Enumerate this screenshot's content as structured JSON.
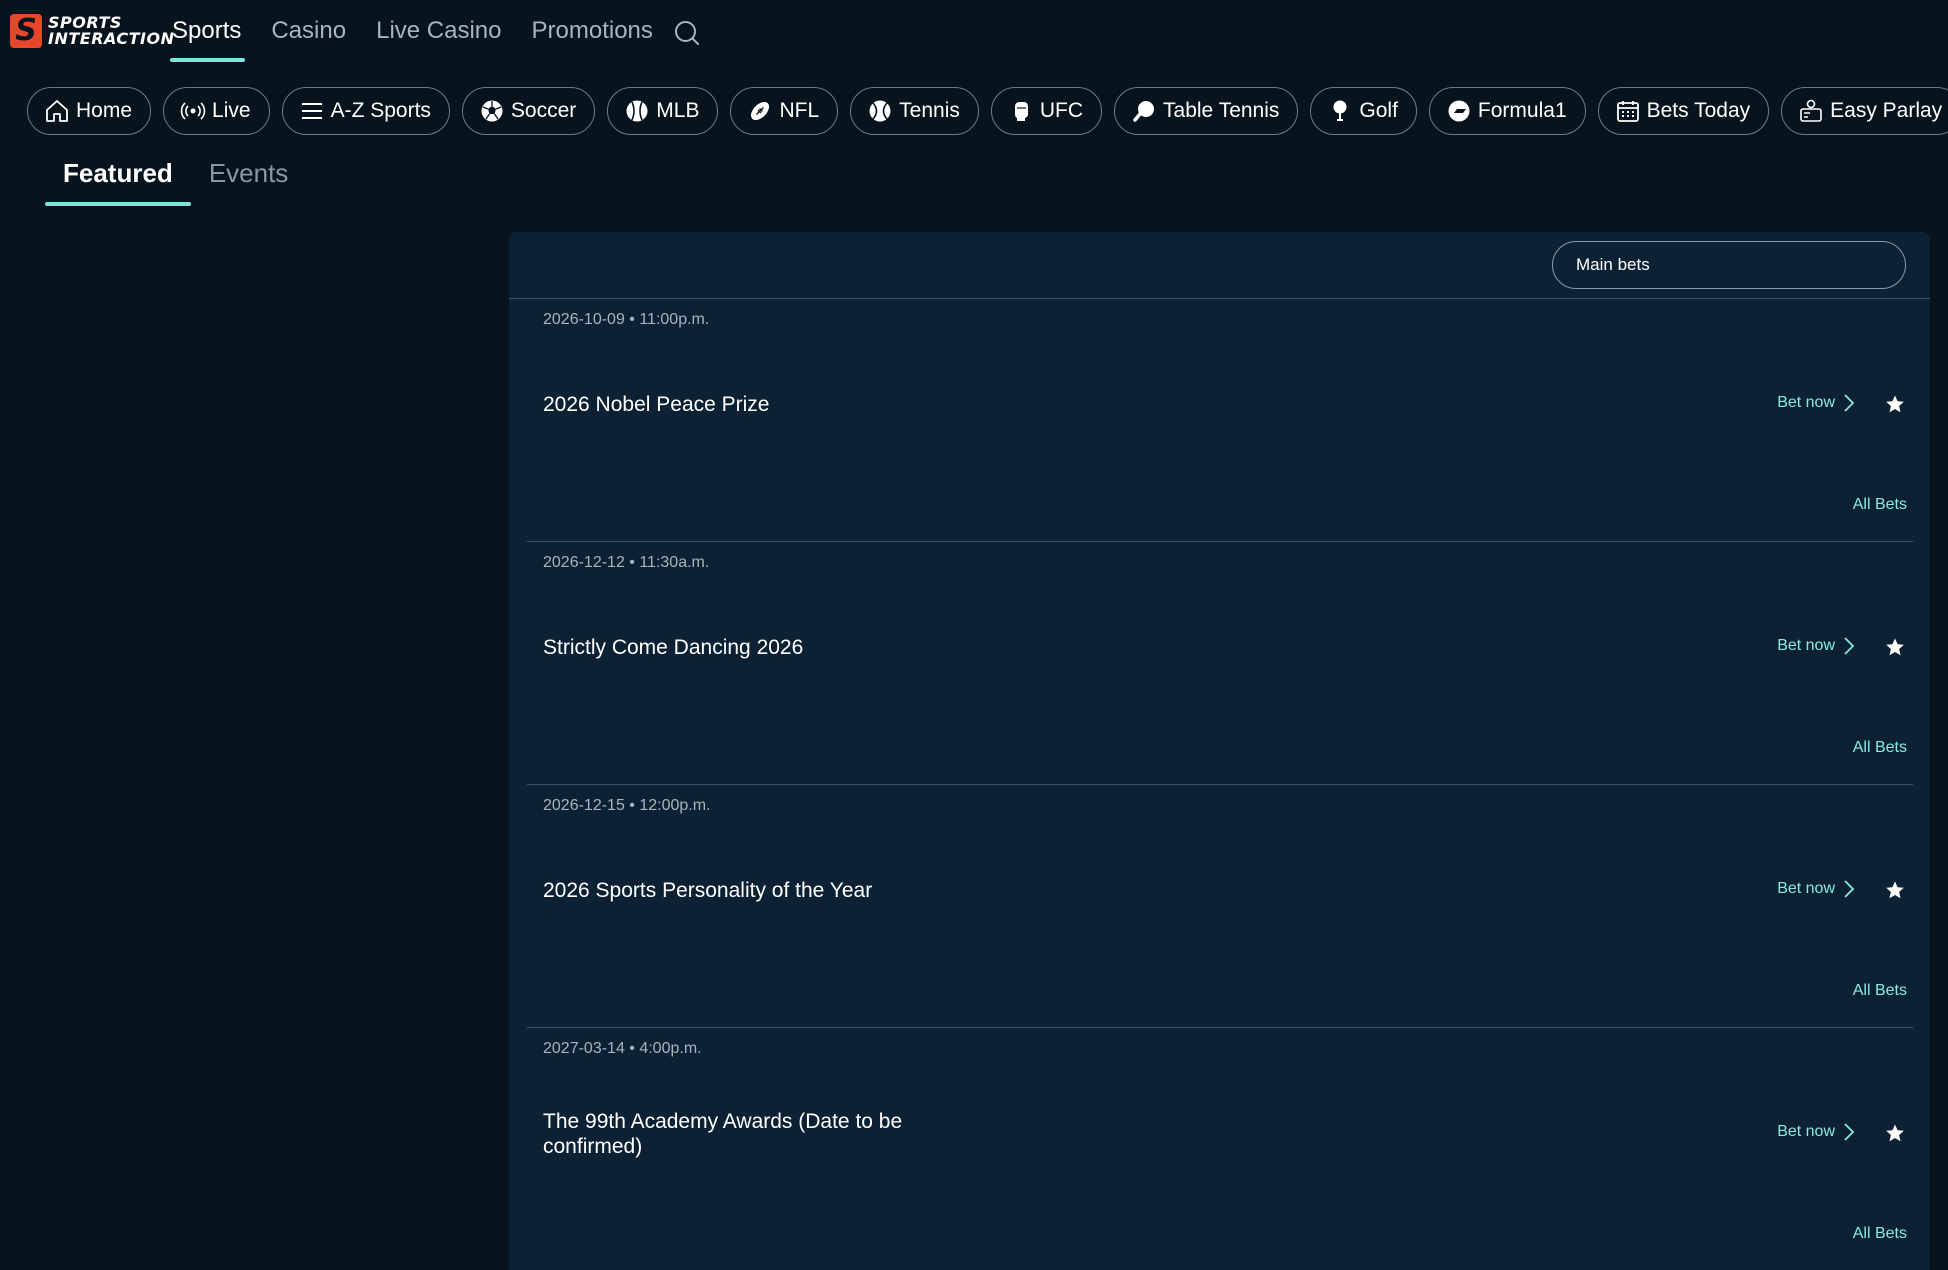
{
  "brand": {
    "line1": "SPORTS",
    "line2": "INTERACTION",
    "mark": "S"
  },
  "top_nav": [
    "Sports",
    "Casino",
    "Live Casino",
    "Promotions"
  ],
  "chips": [
    {
      "label": "Home",
      "icon": "home-icon"
    },
    {
      "label": "Live",
      "icon": "live-icon"
    },
    {
      "label": "A-Z Sports",
      "icon": "menu-icon"
    },
    {
      "label": "Soccer",
      "icon": "soccer-ball-icon"
    },
    {
      "label": "MLB",
      "icon": "baseball-icon"
    },
    {
      "label": "NFL",
      "icon": "football-icon"
    },
    {
      "label": "Tennis",
      "icon": "tennis-ball-icon"
    },
    {
      "label": "UFC",
      "icon": "glove-icon"
    },
    {
      "label": "Table Tennis",
      "icon": "paddle-icon"
    },
    {
      "label": "Golf",
      "icon": "golf-icon"
    },
    {
      "label": "Formula1",
      "icon": "formula1-icon"
    },
    {
      "label": "Bets Today",
      "icon": "calendar-icon"
    },
    {
      "label": "Easy Parlay",
      "icon": "parlay-icon"
    }
  ],
  "tabs": [
    "Featured",
    "Events"
  ],
  "panel": {
    "market_select": "Main bets"
  },
  "events": [
    {
      "date": "2026-10-09 • 11:00p.m.",
      "title": "2026 Nobel Peace Prize",
      "bet_now": "Bet now",
      "all_bets": "All Bets"
    },
    {
      "date": "2026-12-12 • 11:30a.m.",
      "title": "Strictly Come Dancing 2026",
      "bet_now": "Bet now",
      "all_bets": "All Bets"
    },
    {
      "date": "2026-12-15 • 12:00p.m.",
      "title": "2026 Sports Personality of the Year",
      "bet_now": "Bet now",
      "all_bets": "All Bets"
    },
    {
      "date": "2027-03-14 • 4:00p.m.",
      "title": "The 99th Academy Awards (Date to be confirmed)",
      "bet_now": "Bet now",
      "all_bets": "All Bets"
    }
  ],
  "colors": {
    "accent": "#7de3df",
    "background": "#08141d",
    "panel": "#0c2234",
    "logo": "#e8462b"
  }
}
